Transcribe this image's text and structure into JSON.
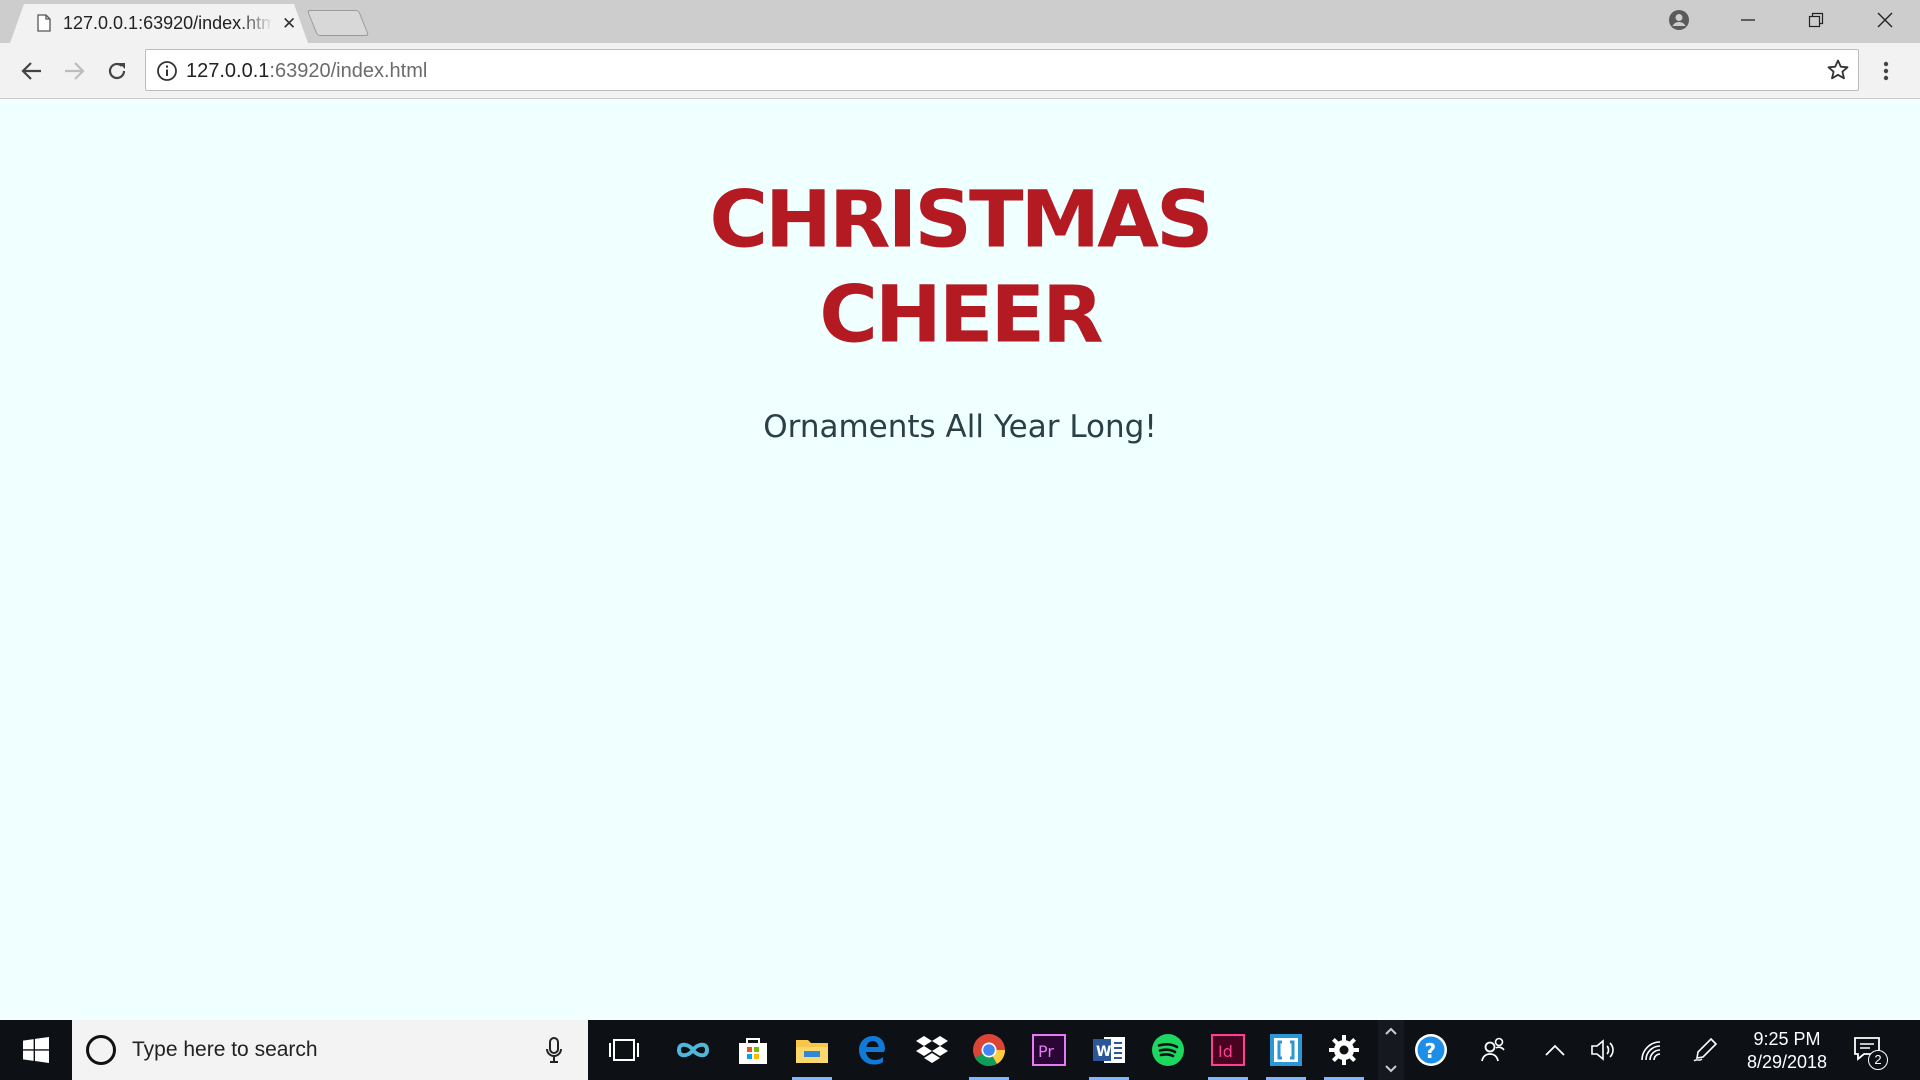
{
  "browser": {
    "tab_title": "127.0.0.1:63920/index.html",
    "tab_close": "✕",
    "url_host": "127.0.0.1",
    "url_rest": ":63920/index.html"
  },
  "page": {
    "title_line1": "CHRISTMAS",
    "title_line2": "CHEER",
    "tagline": "Ornaments All Year Long!"
  },
  "taskbar": {
    "search_placeholder": "Type here to search",
    "clock_time": "9:25 PM",
    "clock_date": "8/29/2018",
    "notification_count": "2"
  },
  "colors": {
    "page_background": "#f0ffff",
    "title": "#b41a22",
    "tagline": "#2a3f46"
  }
}
